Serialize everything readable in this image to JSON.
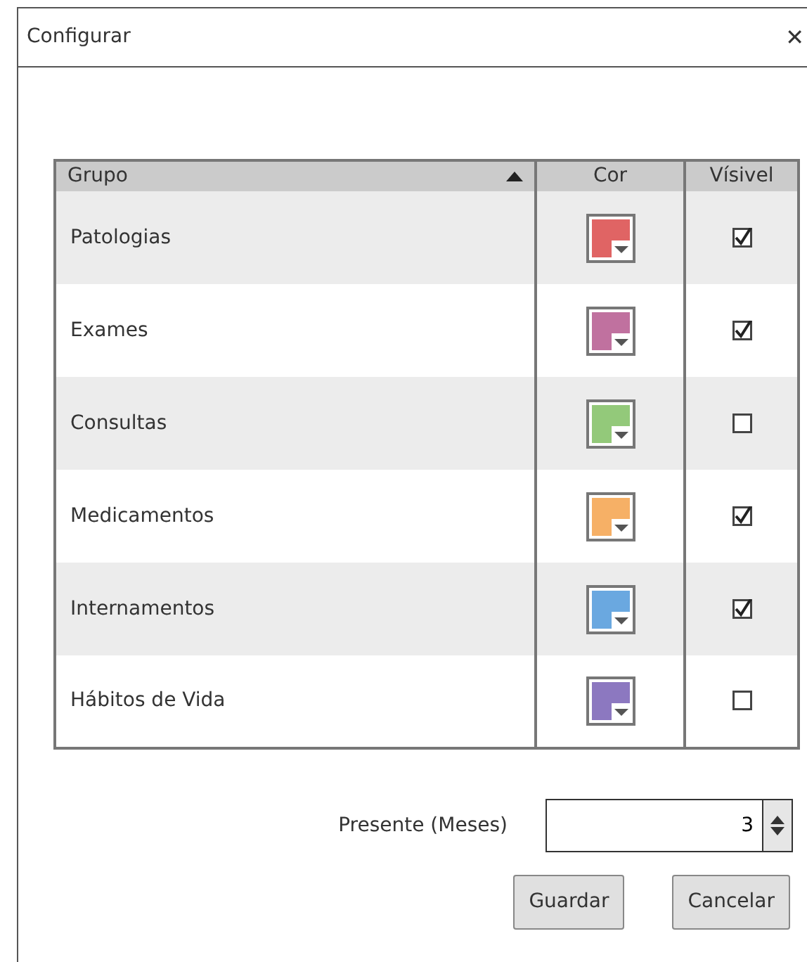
{
  "window": {
    "title": "Configurar",
    "close": "✕"
  },
  "table": {
    "columns": [
      "Grupo",
      "Cor",
      "Vísivel"
    ],
    "rows": [
      {
        "group": "Patologias",
        "color": "#e06464",
        "visible": true
      },
      {
        "group": "Exames",
        "color": "#c0719f",
        "visible": true
      },
      {
        "group": "Consultas",
        "color": "#93c97a",
        "visible": false
      },
      {
        "group": "Medicamentos",
        "color": "#f6b066",
        "visible": true
      },
      {
        "group": "Internamentos",
        "color": "#6aa8e0",
        "visible": true
      },
      {
        "group": "Hábitos de Vida",
        "color": "#8c78c0",
        "visible": false
      }
    ]
  },
  "present": {
    "label": "Presente (Meses)",
    "value": "3"
  },
  "buttons": [
    "Guardar",
    "Cancelar"
  ]
}
